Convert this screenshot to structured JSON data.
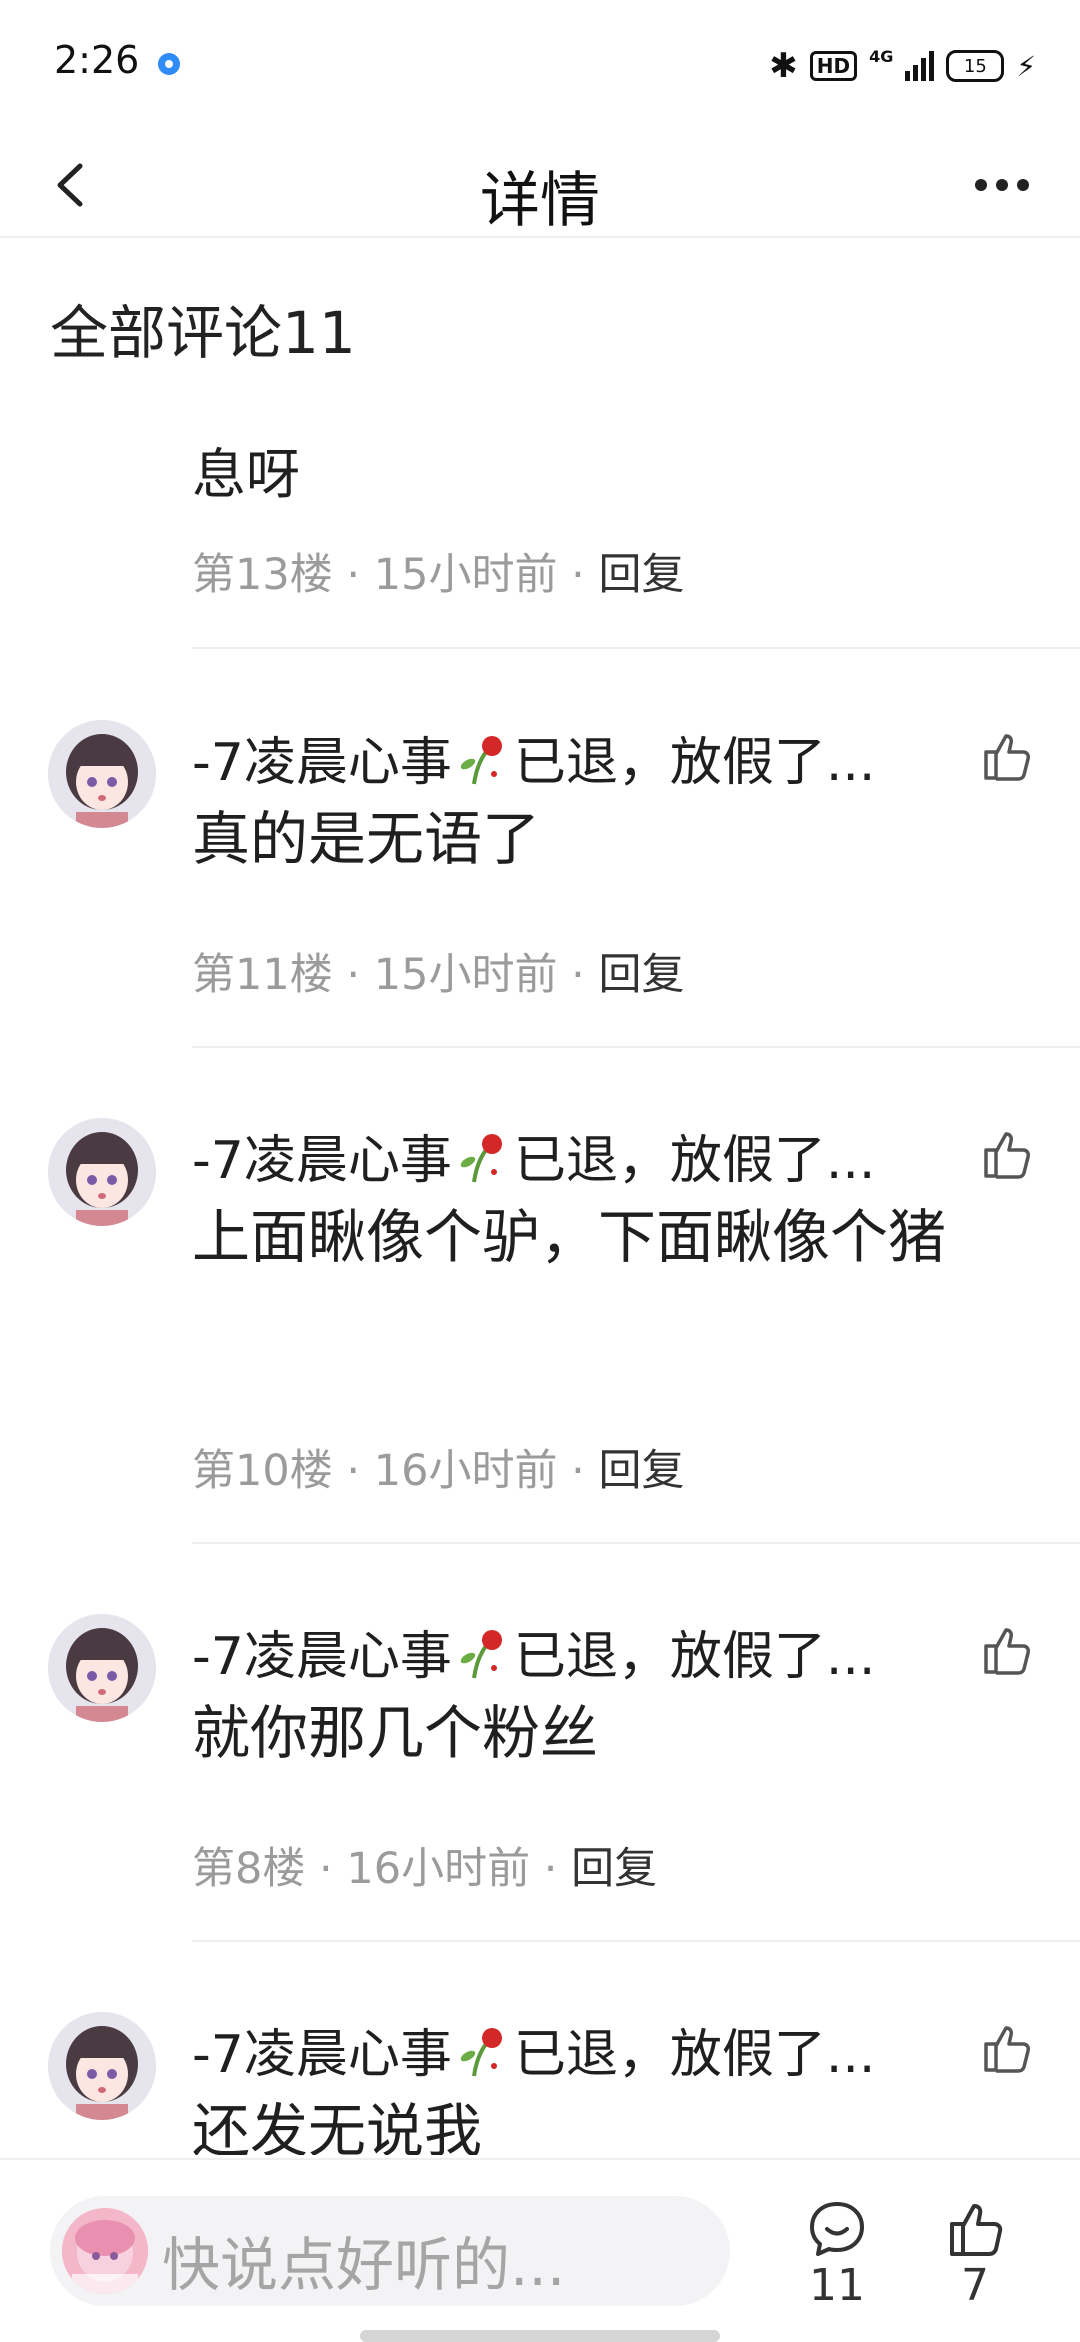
{
  "status_bar": {
    "time": "2:26",
    "network": "4G",
    "hd": "HD",
    "battery": "15"
  },
  "nav": {
    "title": "详情"
  },
  "section": {
    "title": "全部评论11"
  },
  "partial_comment": {
    "text": "息呀",
    "floor": "第13楼",
    "time": "15小时前",
    "reply": "回复"
  },
  "comments": [
    {
      "name_prefix": "-7凌晨心事",
      "name_suffix": "已退，放假了...",
      "text": "真的是无语了",
      "floor": "第11楼",
      "time": "15小时前",
      "reply": "回复"
    },
    {
      "name_prefix": "-7凌晨心事",
      "name_suffix": "已退，放假了...",
      "text": "上面瞅像个驴，下面瞅像个猪",
      "floor": "第10楼",
      "time": "16小时前",
      "reply": "回复"
    },
    {
      "name_prefix": "-7凌晨心事",
      "name_suffix": "已退，放假了...",
      "text": "就你那几个粉丝",
      "floor": "第8楼",
      "time": "16小时前",
      "reply": "回复"
    },
    {
      "name_prefix": "-7凌晨心事",
      "name_suffix": "已退，放假了...",
      "text": "还发无说我"
    }
  ],
  "bottom_bar": {
    "input_placeholder": "快说点好听的...",
    "comment_count": "11",
    "like_count": "7"
  },
  "colors": {
    "meta_gray": "#9b9b9b",
    "accent_blue": "#2f8cf6",
    "divider": "#ededed"
  }
}
